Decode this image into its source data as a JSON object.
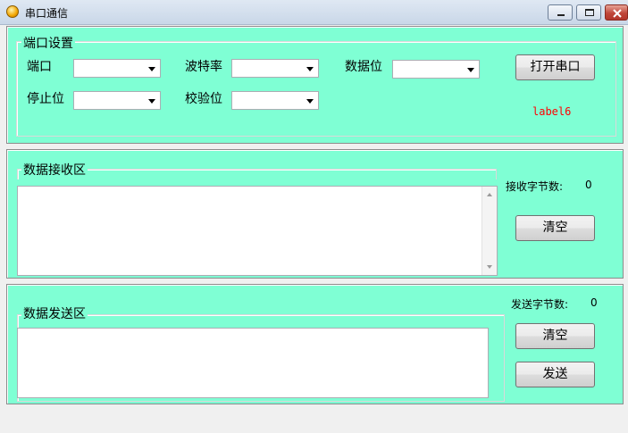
{
  "window": {
    "title": "串口通信"
  },
  "port_group": {
    "legend": "端口设置",
    "port_label": "端口",
    "baud_label": "波特率",
    "databits_label": "数据位",
    "stopbits_label": "停止位",
    "parity_label": "校验位",
    "port_value": "",
    "baud_value": "",
    "databits_value": "",
    "stopbits_value": "",
    "parity_value": "",
    "open_button": "打开串口",
    "status_label": "label6"
  },
  "recv_group": {
    "legend": "数据接收区",
    "bytes_label": "接收字节数:",
    "bytes_value": "0",
    "text": "",
    "clear_button": "清空"
  },
  "send_group": {
    "legend": "数据发送区",
    "bytes_label": "发送字节数:",
    "bytes_value": "0",
    "text": "",
    "clear_button": "清空",
    "send_button": "发送"
  },
  "colors": {
    "panel_bg": "#7fffd4",
    "status_text": "#ff0000"
  },
  "icons": [
    "app-icon",
    "minimize-icon",
    "maximize-icon",
    "close-icon",
    "dropdown-arrow-icon",
    "scroll-up-icon",
    "scroll-down-icon"
  ]
}
